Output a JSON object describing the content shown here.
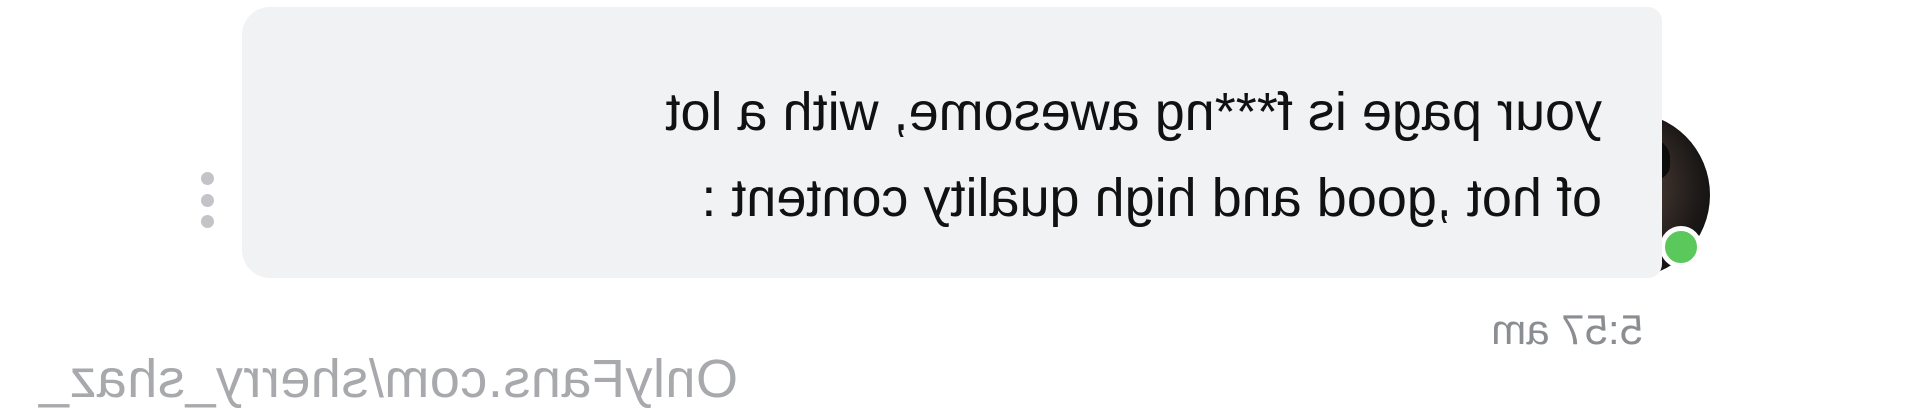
{
  "message": {
    "text": "your page is f***ng awesome, with a lot\nof hot ,good and high quality content :",
    "time": "5:57 am"
  },
  "sender": {
    "avatar_icon": "avatar-photo",
    "online": true,
    "status_color": "#5ac85a"
  },
  "actions": {
    "more_icon": "vertical-ellipsis-icon"
  },
  "watermark": {
    "text": "OnlyFans.com/sherry_shaz_"
  }
}
